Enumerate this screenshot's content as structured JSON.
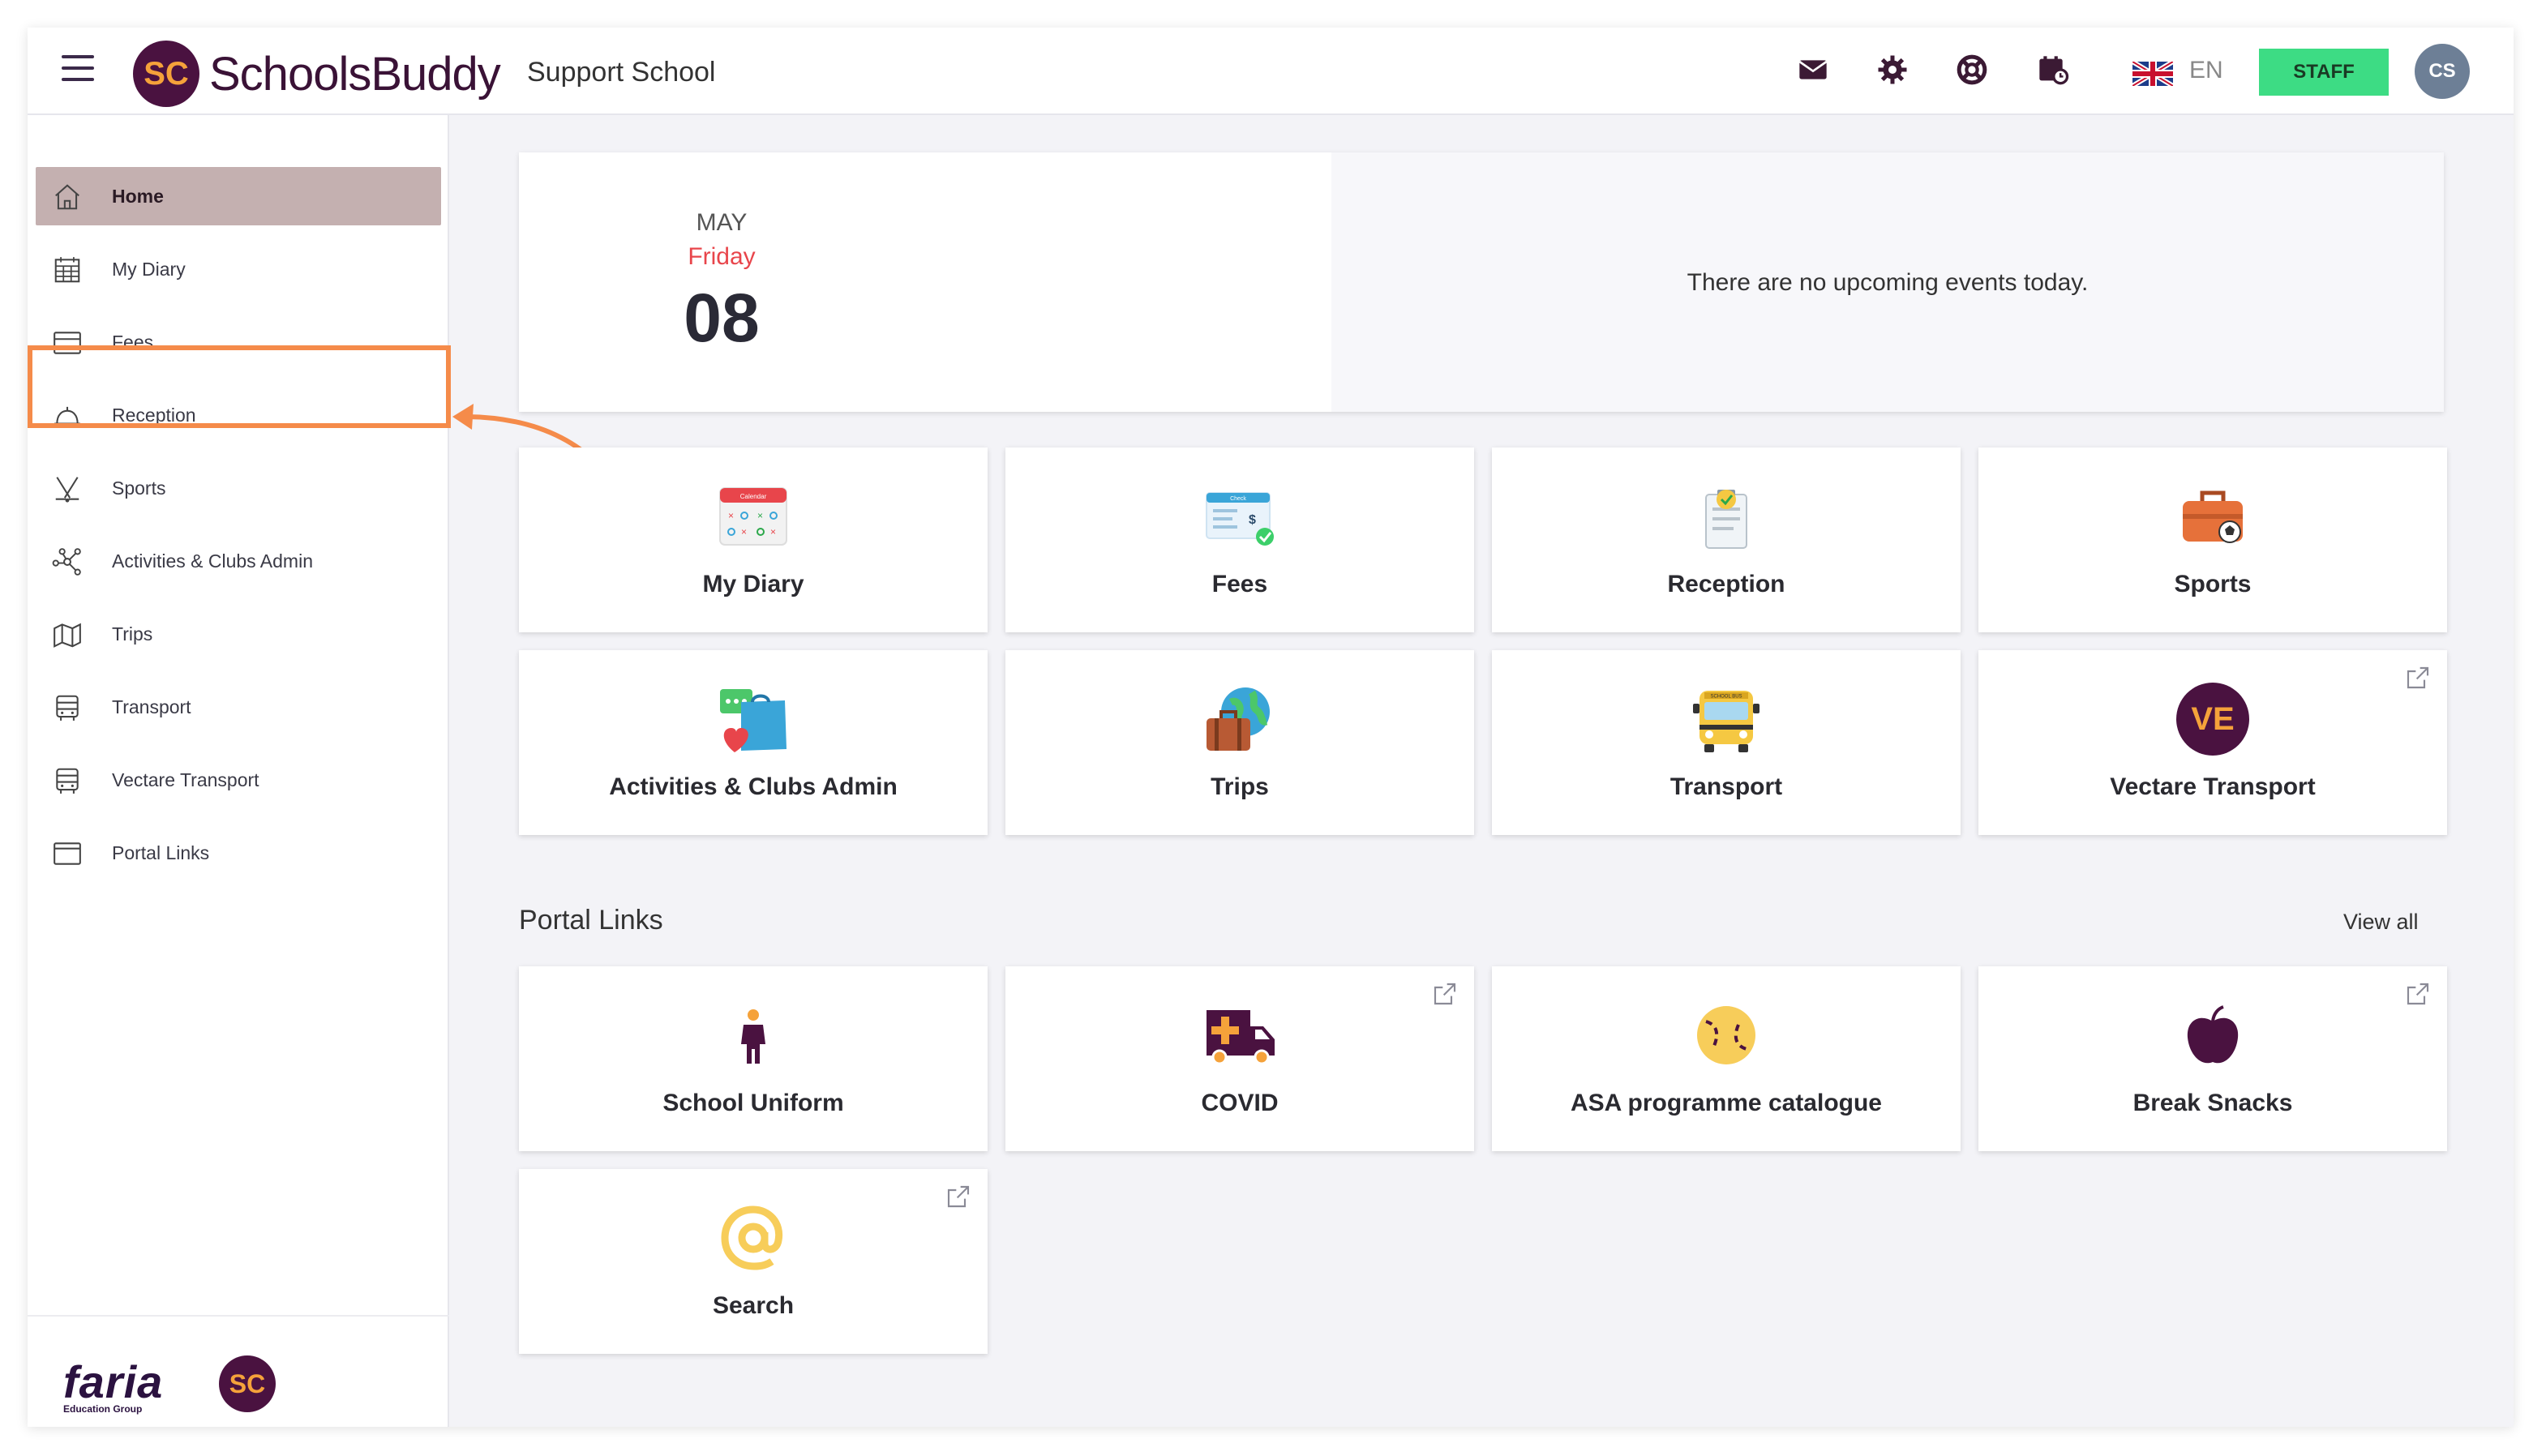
{
  "app": {
    "brand": "SchoolsBuddy",
    "brand_badge": "SC",
    "school_name": "Support School",
    "language": "EN",
    "staff_label": "STAFF",
    "avatar_initials": "CS"
  },
  "sidebar": {
    "items": [
      {
        "label": "Home",
        "icon": "home-icon",
        "active": true
      },
      {
        "label": "My Diary",
        "icon": "calendar-icon"
      },
      {
        "label": "Fees",
        "icon": "card-icon"
      },
      {
        "label": "Reception",
        "icon": "bell-icon"
      },
      {
        "label": "Sports",
        "icon": "sports-icon"
      },
      {
        "label": "Activities & Clubs Admin",
        "icon": "network-icon"
      },
      {
        "label": "Trips",
        "icon": "map-icon"
      },
      {
        "label": "Transport",
        "icon": "bus-icon"
      },
      {
        "label": "Vectare Transport",
        "icon": "bus-icon"
      },
      {
        "label": "Portal Links",
        "icon": "window-icon"
      }
    ],
    "footer_brand": "faria",
    "footer_sub": "Education Group",
    "footer_badge": "SC"
  },
  "date_card": {
    "month": "MAY",
    "weekday": "Friday",
    "day": "08",
    "no_events": "There are no upcoming events today."
  },
  "modules": [
    {
      "label": "My Diary",
      "icon": "calendar-icon"
    },
    {
      "label": "Fees",
      "icon": "cheque-icon"
    },
    {
      "label": "Reception",
      "icon": "clipboard-icon"
    },
    {
      "label": "Sports",
      "icon": "sports-bag-icon"
    },
    {
      "label": "Activities & Clubs Admin",
      "icon": "chat-heart-icon"
    },
    {
      "label": "Trips",
      "icon": "globe-suitcase-icon"
    },
    {
      "label": "Transport",
      "icon": "school-bus-icon"
    },
    {
      "label": "Vectare Transport",
      "icon": "ve-logo-icon",
      "badge": "VE",
      "external": true
    }
  ],
  "portal_links": {
    "title": "Portal Links",
    "view_all": "View all",
    "items": [
      {
        "label": "School Uniform",
        "icon": "person-icon",
        "external": false
      },
      {
        "label": "COVID",
        "icon": "ambulance-icon",
        "external": true
      },
      {
        "label": "ASA programme catalogue",
        "icon": "tennis-ball-icon",
        "external": false
      },
      {
        "label": "Break Snacks",
        "icon": "apple-icon",
        "external": true
      },
      {
        "label": "Search",
        "icon": "at-icon",
        "external": true
      }
    ]
  },
  "colors": {
    "brand_purple": "#4a1240",
    "brand_orange": "#f5a23a",
    "staff_green": "#3ddc84",
    "highlight_orange": "#f58b4a",
    "active_item": "#c4b0b0",
    "weekday_red": "#e8454b"
  }
}
